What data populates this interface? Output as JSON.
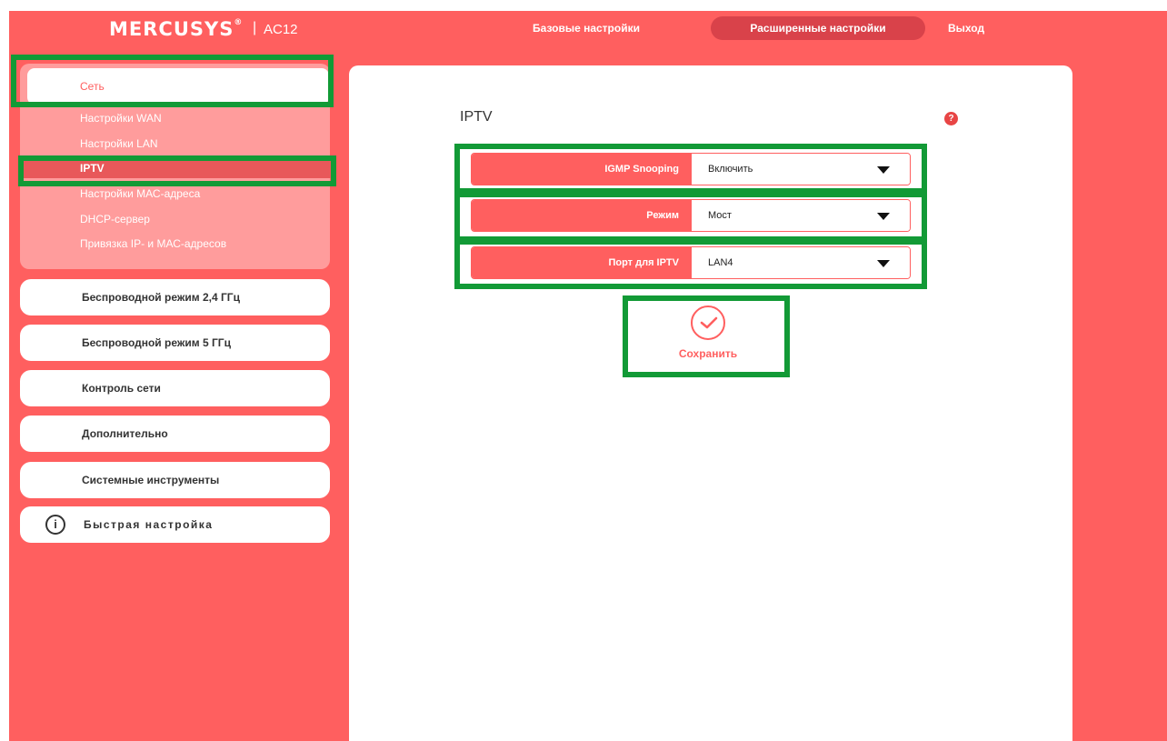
{
  "header": {
    "brand": "MERCUSYS",
    "brand_mark": "®",
    "separator": "|",
    "model": "AC12",
    "nav": {
      "basic": "Базовые настройки",
      "advanced": "Расширенные настройки",
      "exit": "Выход"
    }
  },
  "sidebar": {
    "network": {
      "title": "Сеть",
      "items": [
        "Настройки WAN",
        "Настройки LAN",
        "IPTV",
        "Настройки МАС-адреса",
        "DHCP-сервер",
        "Привязка IP- и МАС-адресов"
      ],
      "active_item": "IPTV"
    },
    "menus": [
      "Беспроводной режим 2,4 ГГц",
      "Беспроводной режим 5 ГГц",
      "Контроль сети",
      "Дополнительно",
      "Системные инструменты"
    ],
    "quick_setup": "Быстрая настройка",
    "quick_setup_icon": "info-icon",
    "quick_setup_icon_glyph": "i"
  },
  "main": {
    "title": "IPTV",
    "help_glyph": "?",
    "fields": [
      {
        "label": "IGMP Snooping",
        "value": "Включить"
      },
      {
        "label": "Режим",
        "value": "Мост"
      },
      {
        "label": "Порт для IPTV",
        "value": "LAN4"
      }
    ],
    "save_label": "Сохранить"
  },
  "colors": {
    "accent": "#ff5f5f",
    "active_tab": "#d9424a",
    "submenu_bg": "#ff9c9c",
    "highlight": "#129a36"
  }
}
